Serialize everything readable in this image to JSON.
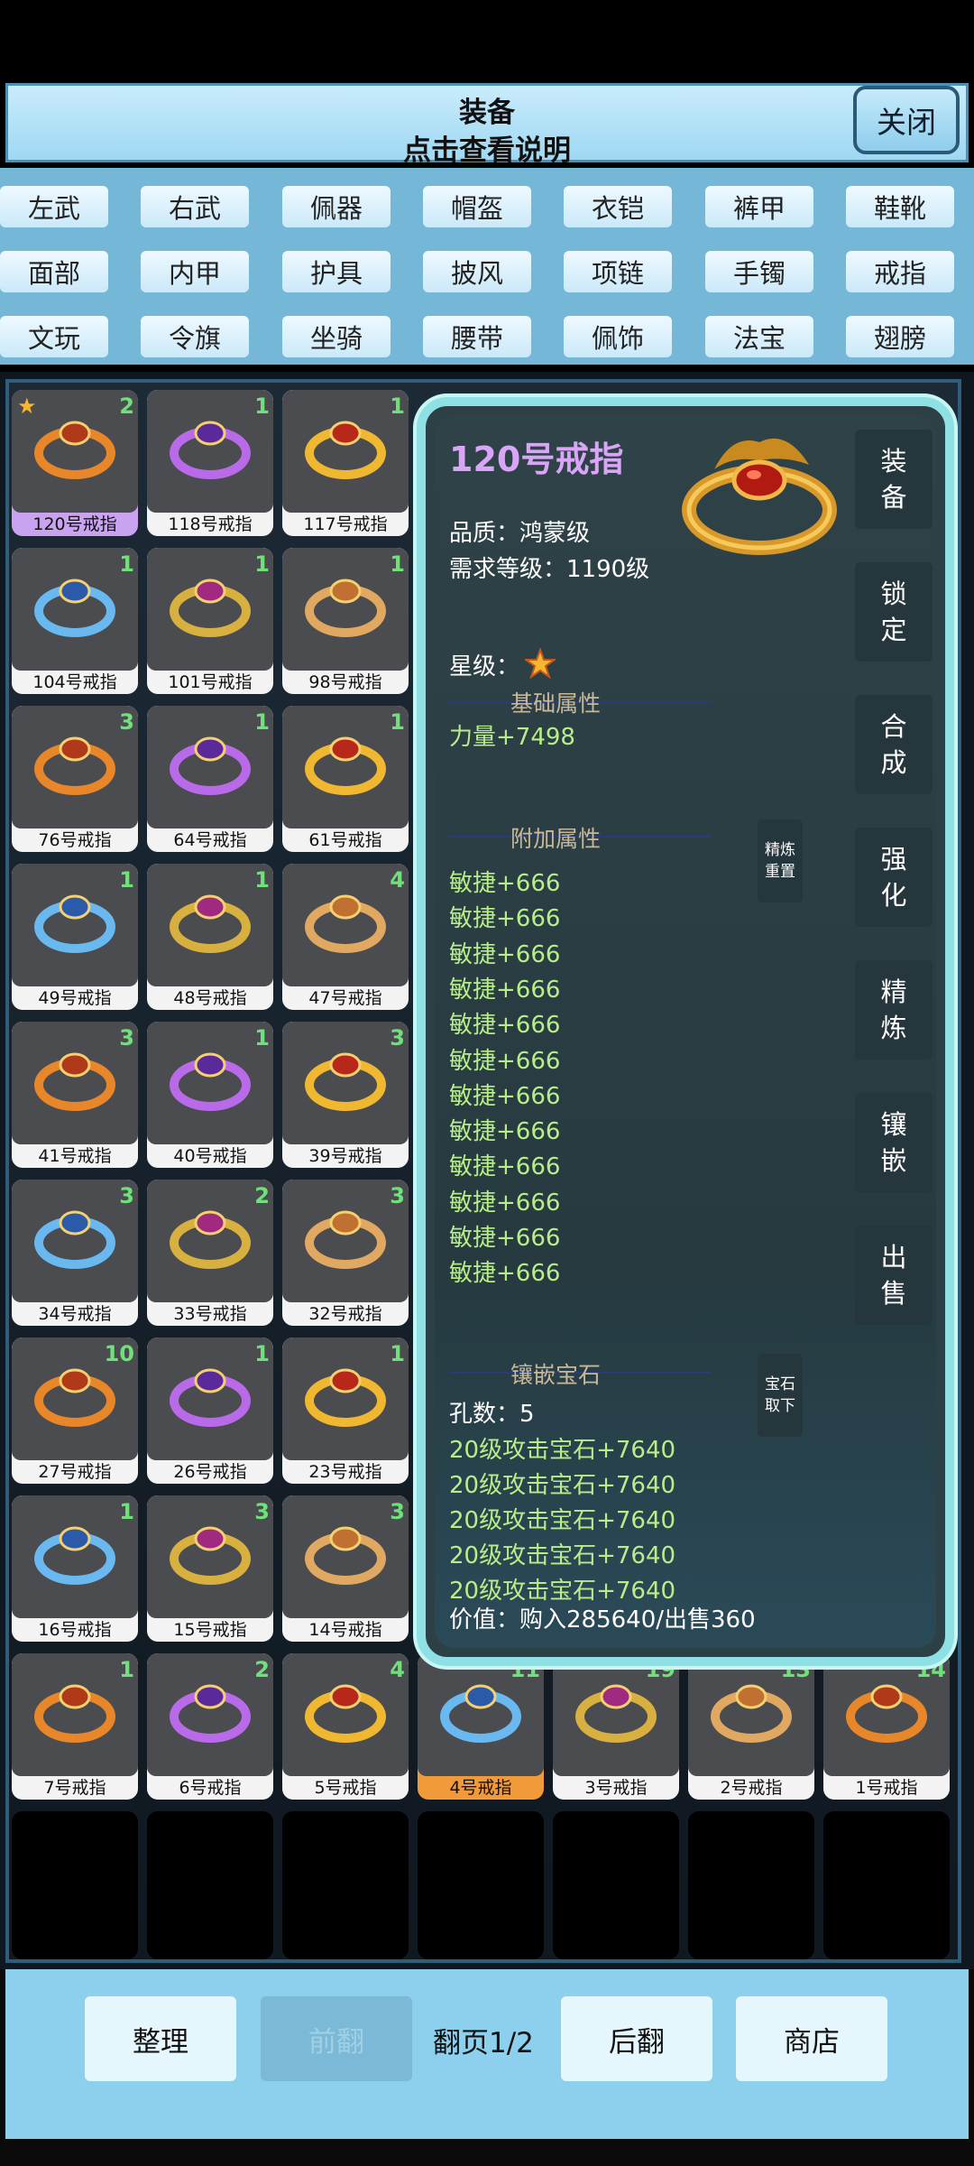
{
  "header": {
    "title": "装备",
    "subtitle": "点击查看说明",
    "close_label": "关闭"
  },
  "tabs": [
    "左武",
    "右武",
    "佩器",
    "帽盔",
    "衣铠",
    "裤甲",
    "鞋靴",
    "面部",
    "内甲",
    "护具",
    "披风",
    "项链",
    "手镯",
    "戒指",
    "文玩",
    "令旗",
    "坐骑",
    "腰带",
    "佩饰",
    "法宝",
    "翅膀"
  ],
  "inventory": {
    "items": [
      {
        "label": "120号戒指",
        "count": "2",
        "selected": true
      },
      {
        "label": "118号戒指",
        "count": "1"
      },
      {
        "label": "117号戒指",
        "count": "1"
      },
      {
        "label": "104号戒指",
        "count": "1"
      },
      {
        "label": "101号戒指",
        "count": "1"
      },
      {
        "label": "98号戒指",
        "count": "1"
      },
      {
        "label": "76号戒指",
        "count": "3"
      },
      {
        "label": "64号戒指",
        "count": "1"
      },
      {
        "label": "61号戒指",
        "count": "1"
      },
      {
        "label": "49号戒指",
        "count": "1"
      },
      {
        "label": "48号戒指",
        "count": "1"
      },
      {
        "label": "47号戒指",
        "count": "4"
      },
      {
        "label": "41号戒指",
        "count": "3"
      },
      {
        "label": "40号戒指",
        "count": "1"
      },
      {
        "label": "39号戒指",
        "count": "3"
      },
      {
        "label": "34号戒指",
        "count": "3"
      },
      {
        "label": "33号戒指",
        "count": "2"
      },
      {
        "label": "32号戒指",
        "count": "3"
      },
      {
        "label": "27号戒指",
        "count": "10"
      },
      {
        "label": "26号戒指",
        "count": "1"
      },
      {
        "label": "23号戒指",
        "count": "1"
      },
      {
        "label": "16号戒指",
        "count": "1"
      },
      {
        "label": "15号戒指",
        "count": "3"
      },
      {
        "label": "14号戒指",
        "count": "3"
      },
      {
        "label": "7号戒指",
        "count": "1"
      },
      {
        "label": "6号戒指",
        "count": "2"
      },
      {
        "label": "5号戒指",
        "count": "4"
      },
      {
        "label": "4号戒指",
        "count": "11",
        "highlight": true
      },
      {
        "label": "3号戒指",
        "count": "19"
      },
      {
        "label": "2号戒指",
        "count": "13"
      },
      {
        "label": "1号戒指",
        "count": "14"
      }
    ]
  },
  "detail": {
    "name": "120号戒指",
    "quality": "品质：鸿蒙级",
    "level_req": "需求等级：1190级",
    "star_label": "星级：",
    "base_header": "基础属性",
    "base_attr": "力量+7498",
    "extra_header": "附加属性",
    "extra_attrs": [
      "敏捷+666",
      "敏捷+666",
      "敏捷+666",
      "敏捷+666",
      "敏捷+666",
      "敏捷+666",
      "敏捷+666",
      "敏捷+666",
      "敏捷+666",
      "敏捷+666",
      "敏捷+666",
      "敏捷+666"
    ],
    "refine_reset": [
      "精炼",
      "重置"
    ],
    "gem_header": "镶嵌宝石",
    "gem_remove": [
      "宝石",
      "取下"
    ],
    "holes": "孔数：5",
    "gems": [
      "20级攻击宝石+7640",
      "20级攻击宝石+7640",
      "20级攻击宝石+7640",
      "20级攻击宝石+7640",
      "20级攻击宝石+7640"
    ],
    "value": "价值：购入285640/出售360",
    "actions": [
      [
        "装",
        "备"
      ],
      [
        "锁",
        "定"
      ],
      [
        "合",
        "成"
      ],
      [
        "强",
        "化"
      ],
      [
        "精",
        "炼"
      ],
      [
        "镶",
        "嵌"
      ],
      [
        "出",
        "售"
      ]
    ]
  },
  "bottom": {
    "sort": "整理",
    "prev": "前翻",
    "page": "翻页1/2",
    "next": "后翻",
    "shop": "商店"
  },
  "colors": {
    "accent": "#8dd0ee",
    "selected": "#c9a3f0",
    "highlight": "#f09a3a",
    "count": "#6fe07a",
    "attr_green": "#b8ee8a",
    "panel_border": "#8fe0e4"
  }
}
